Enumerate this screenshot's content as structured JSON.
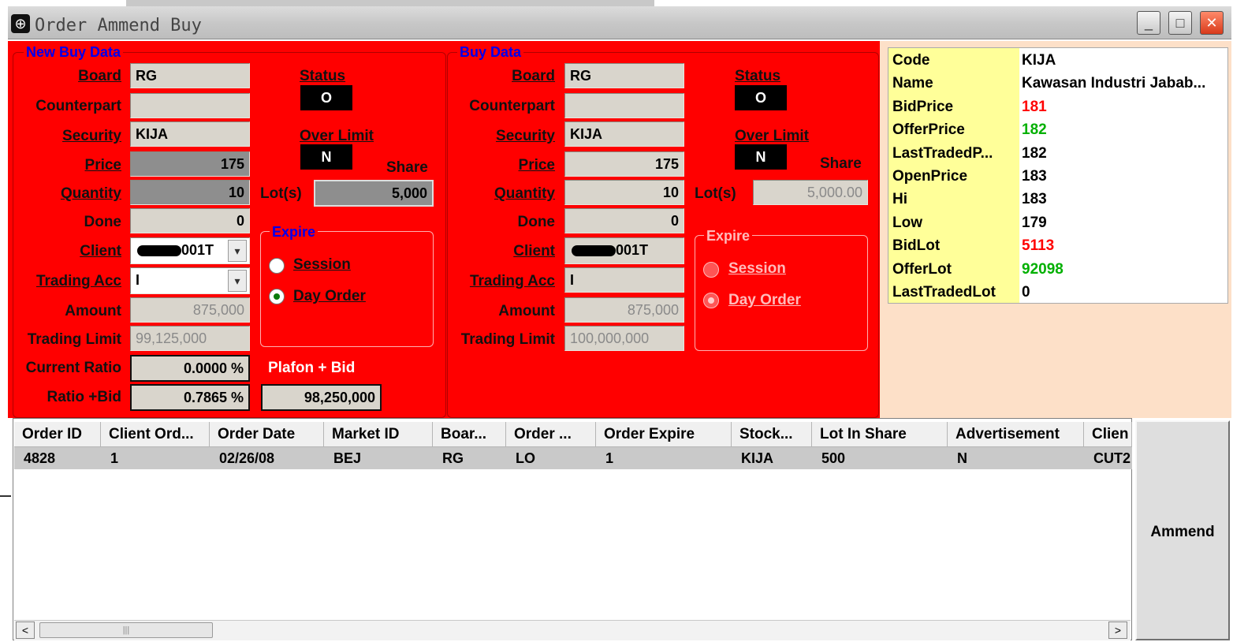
{
  "window": {
    "title": "Order Ammend Buy",
    "minimize": "_",
    "maximize": "□",
    "close": "✕"
  },
  "new_buy": {
    "group_title": "New Buy Data",
    "labels": {
      "board": "Board",
      "counterpart": "Counterpart",
      "security": "Security",
      "price": "Price",
      "quantity": "Quantity",
      "done": "Done",
      "client": "Client",
      "trading_acc": "Trading Acc",
      "amount": "Amount",
      "trading_limit": "Trading Limit",
      "current_ratio": "Current Ratio",
      "ratio_bid": "Ratio +Bid",
      "lots": "Lot(s)",
      "share": "Share",
      "plafon_bid": "Plafon + Bid",
      "status": "Status",
      "over_limit": "Over Limit"
    },
    "values": {
      "board": "RG",
      "counterpart": "",
      "security": "KIJA",
      "price": "175",
      "quantity": "10",
      "done": "0",
      "client": "001T",
      "trading_acc": "I",
      "amount": "875,000",
      "trading_limit": "99,125,000",
      "current_ratio": "0.0000 %",
      "ratio_bid": "0.7865 %",
      "share": "5,000",
      "plafon_bid": "98,250,000",
      "status": "O",
      "over_limit": "N"
    },
    "expire": {
      "title": "Expire",
      "session": "Session",
      "day_order": "Day Order",
      "selected": "Day Order"
    }
  },
  "buy": {
    "group_title": "Buy Data",
    "labels": {
      "board": "Board",
      "counterpart": "Counterpart",
      "security": "Security",
      "price": "Price",
      "quantity": "Quantity",
      "done": "Done",
      "client": "Client",
      "trading_acc": "Trading Acc",
      "amount": "Amount",
      "trading_limit": "Trading Limit",
      "lots": "Lot(s)",
      "share": "Share",
      "status": "Status",
      "over_limit": "Over Limit"
    },
    "values": {
      "board": "RG",
      "counterpart": "",
      "security": "KIJA",
      "price": "175",
      "quantity": "10",
      "done": "0",
      "client": "001T",
      "trading_acc": "I",
      "amount": "875,000",
      "trading_limit": "100,000,000",
      "share": "5,000.00",
      "status": "O",
      "over_limit": "N"
    },
    "expire": {
      "title": "Expire",
      "session": "Session",
      "day_order": "Day Order",
      "selected": "Day Order"
    }
  },
  "quote": [
    {
      "label": "Code",
      "value": "KIJA",
      "color": "#000000"
    },
    {
      "label": "Name",
      "value": "Kawasan Industri Jabab...",
      "color": "#000000"
    },
    {
      "label": "BidPrice",
      "value": "181",
      "color": "#ff0000"
    },
    {
      "label": "OfferPrice",
      "value": "182",
      "color": "#00b000"
    },
    {
      "label": "LastTradedP...",
      "value": "182",
      "color": "#000000"
    },
    {
      "label": "OpenPrice",
      "value": "183",
      "color": "#000000"
    },
    {
      "label": "Hi",
      "value": "183",
      "color": "#000000"
    },
    {
      "label": "Low",
      "value": "179",
      "color": "#000000"
    },
    {
      "label": "BidLot",
      "value": "5113",
      "color": "#ff0000"
    },
    {
      "label": "OfferLot",
      "value": "92098",
      "color": "#00b000"
    },
    {
      "label": "LastTradedLot",
      "value": "0",
      "color": "#000000"
    }
  ],
  "grid": {
    "columns": [
      "Order ID",
      "Client Ord...",
      "Order Date",
      "Market ID",
      "Boar...",
      "Order ...",
      "Order Expire",
      "Stock...",
      "Lot In Share",
      "Advertisement",
      "Clien"
    ],
    "rows": [
      [
        "4828",
        "1",
        "02/26/08",
        "BEJ",
        "RG",
        "LO",
        "1",
        "KIJA",
        "500",
        "N",
        "CUT2"
      ]
    ]
  },
  "buttons": {
    "ammend": "Ammend"
  },
  "scroll": {
    "left": "<",
    "right": ">",
    "thumb": "|||"
  }
}
